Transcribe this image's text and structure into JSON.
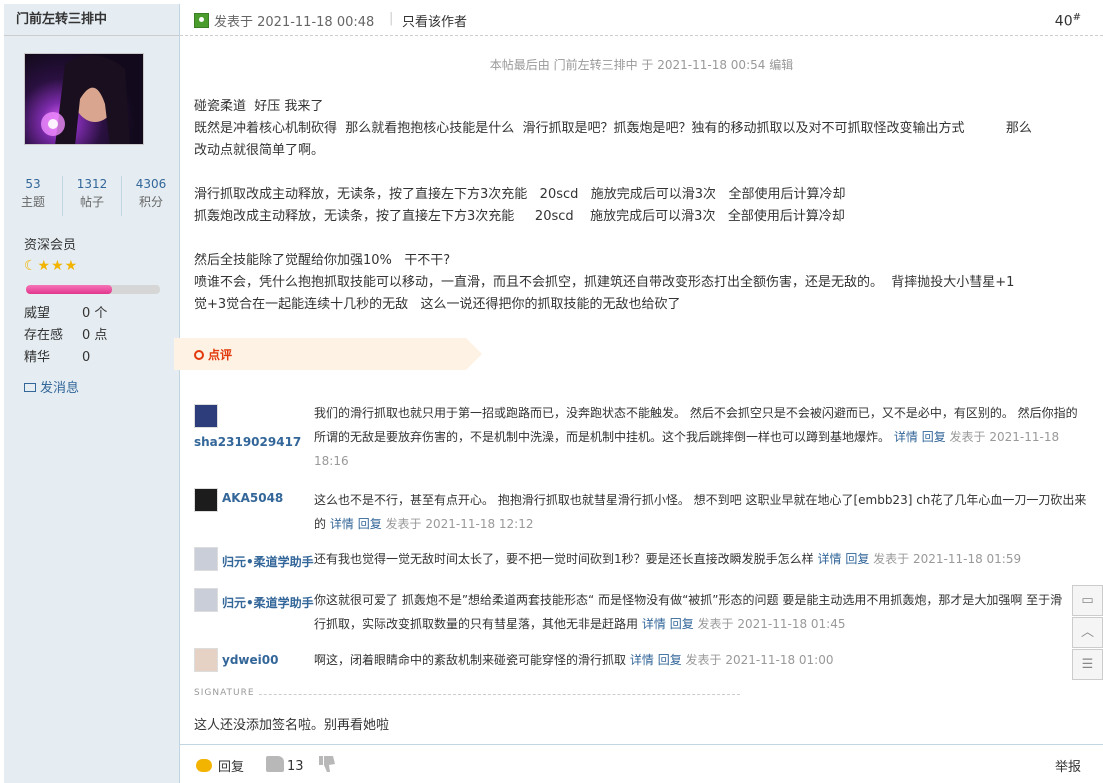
{
  "user": {
    "name": "门前左转三排中",
    "stats": [
      {
        "num": "53",
        "label": "主题"
      },
      {
        "num": "1312",
        "label": "帖子"
      },
      {
        "num": "4306",
        "label": "积分"
      }
    ],
    "level": "资深会员",
    "stars": "☾★★★",
    "xp_fraction": 0.64,
    "attrs": [
      {
        "k": "威望",
        "v": "0 个"
      },
      {
        "k": "存在感",
        "v": "0 点"
      },
      {
        "k": "精华",
        "v": "0"
      }
    ],
    "pm_label": "发消息"
  },
  "post": {
    "time": "发表于 2021-11-18 00:48",
    "sep": "|",
    "only_author": "只看该作者",
    "floor": "40",
    "floor_mark": "#",
    "edit_note": "本帖最后由 门前左转三排中 于 2021-11-18 00:54 编辑",
    "lines": {
      "l1": "碰瓷柔道  好压 我来了",
      "l2": "既然是冲着核心机制砍得  那么就看抱抱核心技能是什么  滑行抓取是吧？抓轰炮是吧？独有的移动抓取以及对不可抓取怪改变输出方式          那么",
      "l3": "改动点就很简单了啊。",
      "l4": "滑行抓取改成主动释放，无读条，按了直接左下方3次充能   20scd   施放完成后可以滑3次   全部使用后计算冷却",
      "l5": "抓轰炮改成主动释放，无读条，按了直接左下方3次充能     20scd    施放完成后可以滑3次   全部使用后计算冷却",
      "l6": "然后全技能除了觉醒给你加强10%   干不干?",
      "l7": "喷谁不会，凭什么抱抱抓取技能可以移动，一直滑，而且不会抓空，抓建筑还自带改变形态打出全额伤害，还是无敌的。  背摔抛投大小彗星+1",
      "l8": "觉+3觉合在一起能连续十几秒的无敌   这么一说还得把你的抓取技能的无敌也给砍了"
    }
  },
  "comments": {
    "section_label": "点评",
    "detail": "详情",
    "reply": "回复",
    "items": [
      {
        "user": "sha2319029417",
        "l1": "我们的滑行抓取也就只用于第一招或跑路而已，没奔跑状态不能触发。 然后不会抓空只是不会被闪避而已，又不是必中，有区别的。 然后你指的",
        "l2": "所谓的无敌是要放弃伤害的，不是机制中洗澡，而是机制中挂机。这个我后跳摔倒一样也可以蹲到基地爆炸。",
        "l3": "18:16",
        "meta": "发表于 2021-11-18"
      },
      {
        "user": "AKA5048",
        "l1": "这么也不是不行，甚至有点开心。 抱抱滑行抓取也就彗星滑行抓小怪。 想不到吧 这职业早就在地心了[embb23] ch花了几年心血一刀一刀砍出来",
        "l2": "的",
        "meta": "发表于 2021-11-18 12:12"
      },
      {
        "user": "归元•柔道学助手",
        "l1": "还有我也觉得一觉无敌时间太长了，要不把一觉时间砍到1秒？要是还长直接改瞬发脱手怎么样",
        "meta": "发表于 2021-11-18 01:59"
      },
      {
        "user": "归元•柔道学助手",
        "l1": "你这就很可爱了 抓轰炮不是”想给柔道两套技能形态“ 而是怪物没有做“被抓”形态的问题 要是能主动选用不用抓轰炮，那才是大加强啊 至于滑",
        "l2": "行抓取，实际改变抓取数量的只有彗星落，其他无非是赶路用",
        "meta": "发表于 2021-11-18 01:45"
      },
      {
        "user": "ydwei00",
        "l1": "啊这，闭着眼睛命中的紊敌机制来碰瓷可能穿怪的滑行抓取",
        "meta": "发表于 2021-11-18 01:00"
      }
    ]
  },
  "signature": {
    "label": "SIGNATURE",
    "text": "这人还没添加签名啦。别再看她啦"
  },
  "footer": {
    "reply": "回复",
    "likes": "13",
    "report": "举报"
  },
  "colors": {
    "sidebar_bg": "#e5edf2",
    "link": "#336699",
    "accent_red": "#e2380b"
  }
}
